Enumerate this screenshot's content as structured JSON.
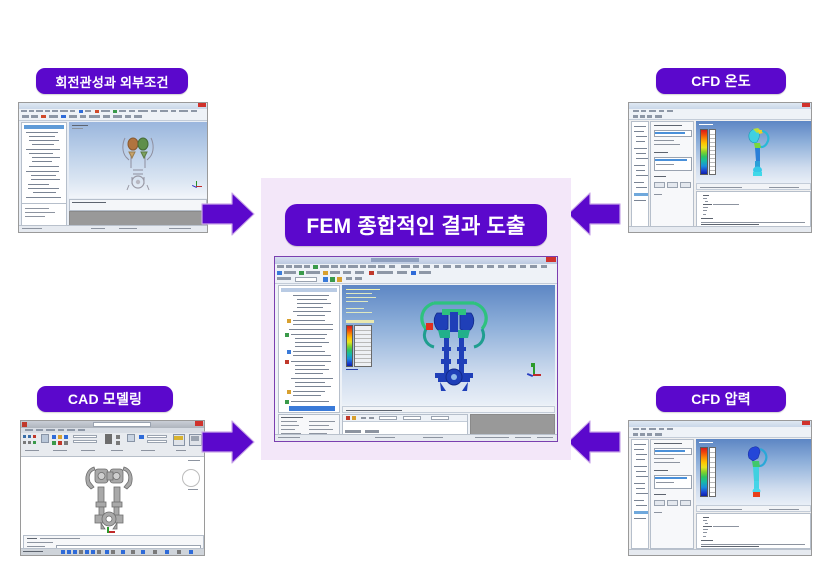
{
  "diagram": {
    "title_flow": "FEM 종합적인 결과 도출",
    "background_color": "#ffffff",
    "accent_color": "#5B08CC",
    "hub_background_color": "#F3E7F9"
  },
  "nodes": {
    "top_left": {
      "label": "회전관성과 외부조건",
      "screenshot_alt": "FEM pre-processor window with model tree and 3D assembly view"
    },
    "top_right": {
      "label": "CFD 온도",
      "screenshot_alt": "CFD post-processor window with temperature contour legend and colored part"
    },
    "bottom_left": {
      "label": "CAD 모델링",
      "screenshot_alt": "AutoCAD window with ribbon toolbar and 2D grey part drawing"
    },
    "bottom_right": {
      "label": "CFD 압력",
      "screenshot_alt": "CFD post-processor window with pressure contour legend and colored part"
    },
    "center": {
      "label": "FEM 종합적인 결과 도출",
      "screenshot_alt": "FEM solver window with model tree, stress contour legend and green/blue result plot"
    }
  },
  "arrows": [
    {
      "name": "arrow-top-left-to-center",
      "direction": "right",
      "color": "#5B08CC"
    },
    {
      "name": "arrow-top-right-to-center",
      "direction": "left",
      "color": "#5B08CC"
    },
    {
      "name": "arrow-bottom-left-to-center",
      "direction": "right",
      "color": "#5B08CC"
    },
    {
      "name": "arrow-bottom-right-to-center",
      "direction": "left",
      "color": "#5B08CC"
    }
  ],
  "icons": {
    "arrow_right": "arrow-right-icon",
    "arrow_left": "arrow-left-icon",
    "legend_bar": "color-legend-icon",
    "axis_triad": "axis-triad-icon"
  }
}
